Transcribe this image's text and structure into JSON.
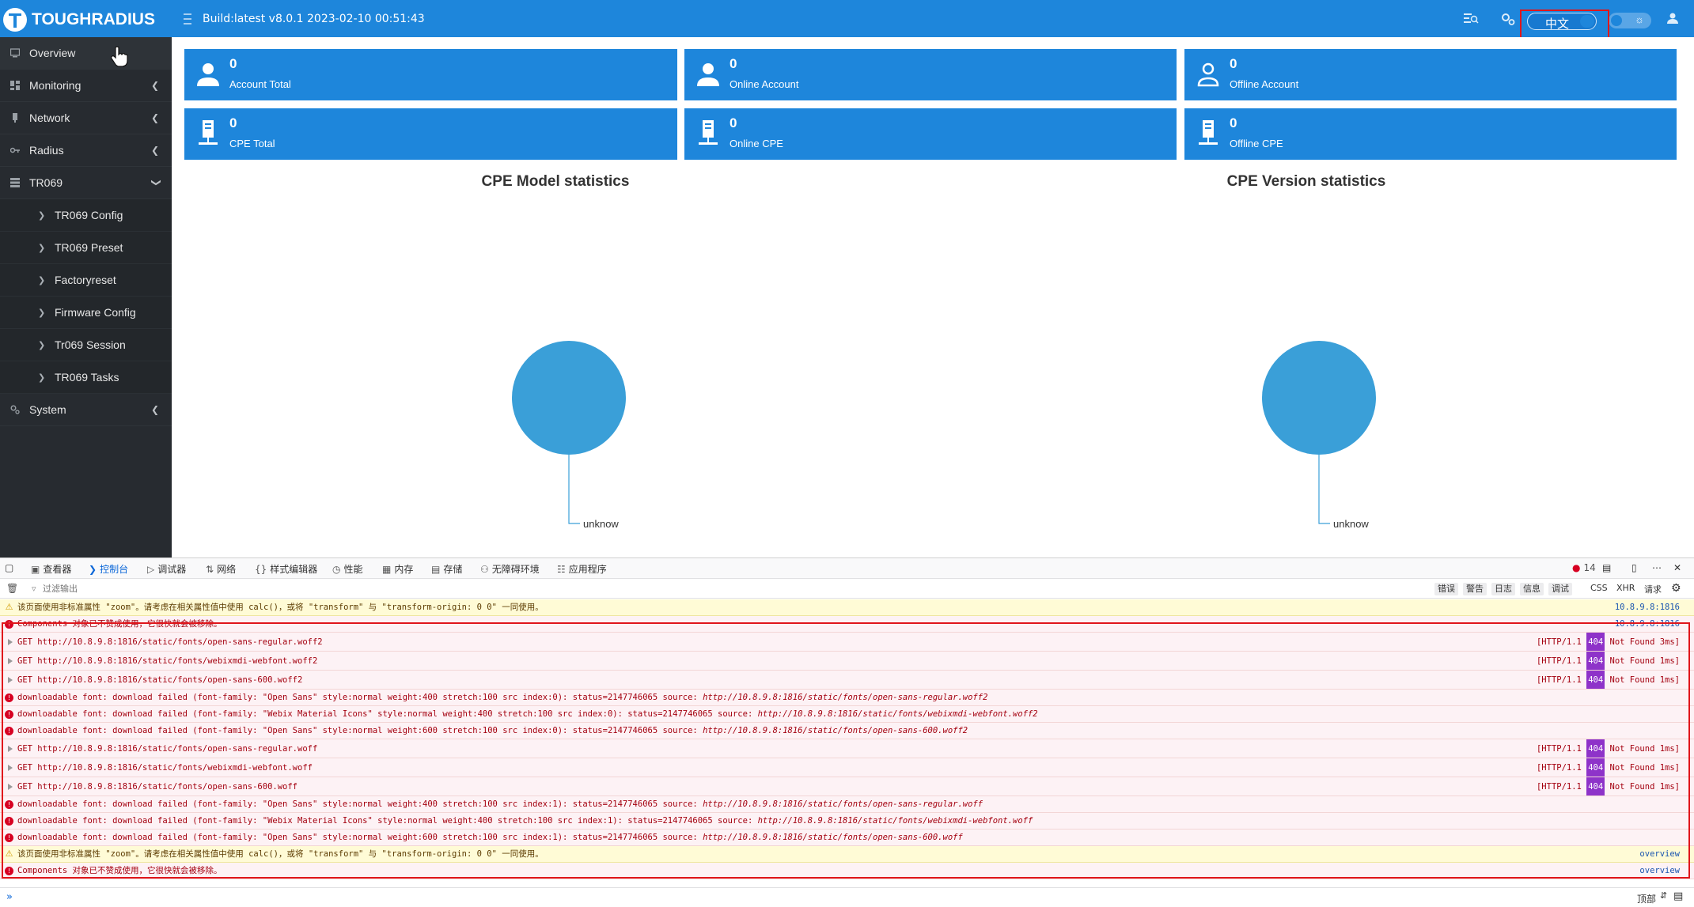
{
  "header": {
    "logo_text": "TOUGHRADIUS",
    "build_info": "Build:latest v8.0.1 2023-02-10 00:51:43",
    "lang_label": "中文",
    "theme_label": "☼"
  },
  "sidebar": {
    "items": [
      {
        "label": "Overview",
        "icon": "monitor-icon"
      },
      {
        "label": "Monitoring",
        "icon": "dashboard-icon"
      },
      {
        "label": "Network",
        "icon": "network-icon"
      },
      {
        "label": "Radius",
        "icon": "key-icon"
      },
      {
        "label": "TR069",
        "icon": "server-icon"
      },
      {
        "label": "System",
        "icon": "gears-icon"
      }
    ],
    "tr069_children": [
      "TR069 Config",
      "TR069 Preset",
      "Factoryreset",
      "Firmware Config",
      "Tr069 Session",
      "TR069 Tasks"
    ]
  },
  "cards": [
    {
      "value": "0",
      "label": "Account Total",
      "icon": "user-icon"
    },
    {
      "value": "0",
      "label": "Online Account",
      "icon": "user-icon"
    },
    {
      "value": "0",
      "label": "Offline Account",
      "icon": "user-outline-icon"
    },
    {
      "value": "0",
      "label": "CPE Total",
      "icon": "device-icon"
    },
    {
      "value": "0",
      "label": "Online CPE",
      "icon": "device-icon"
    },
    {
      "value": "0",
      "label": "Offline CPE",
      "icon": "device-icon"
    }
  ],
  "charts": {
    "model_title": "CPE Model statistics",
    "version_title": "CPE Version statistics"
  },
  "chart_data": [
    {
      "type": "pie",
      "title": "CPE Model statistics",
      "categories": [
        "unknow"
      ],
      "values": [
        1
      ],
      "color": "#3a9fd8"
    },
    {
      "type": "pie",
      "title": "CPE Version statistics",
      "categories": [
        "unknow"
      ],
      "values": [
        1
      ],
      "color": "#3a9fd8"
    }
  ],
  "devtools": {
    "tabs": [
      {
        "label": "查看器",
        "icon": "inspector-icon"
      },
      {
        "label": "控制台",
        "icon": "console-icon"
      },
      {
        "label": "调试器",
        "icon": "debugger-icon"
      },
      {
        "label": "网络",
        "icon": "network-icon"
      },
      {
        "label": "样式编辑器",
        "icon": "style-editor-icon"
      },
      {
        "label": "性能",
        "icon": "performance-icon"
      },
      {
        "label": "内存",
        "icon": "memory-icon"
      },
      {
        "label": "存储",
        "icon": "storage-icon"
      },
      {
        "label": "无障碍环境",
        "icon": "accessibility-icon"
      },
      {
        "label": "应用程序",
        "icon": "application-icon"
      }
    ],
    "error_count": "14",
    "filter_placeholder": "过滤输出",
    "filter_buttons": [
      "错误",
      "警告",
      "日志",
      "信息",
      "调试"
    ],
    "filter_extra": [
      "CSS",
      "XHR",
      "请求"
    ],
    "input_position_label": "顶部",
    "log": [
      {
        "kind": "warn",
        "text": "该页面使用非标准属性 \"zoom\"。请考虑在相关属性值中使用 calc()，或将 \"transform\" 与 \"transform-origin: 0 0\" 一同使用。",
        "src": "10.8.9.8:1816"
      },
      {
        "kind": "err",
        "text": "Components 对象已不赞成使用，它很快就会被移除。",
        "src": "10.8.9.8:1816"
      },
      {
        "kind": "net",
        "text": "GET http://10.8.9.8:1816/static/fonts/open-sans-regular.woff2",
        "http_pre": "[HTTP/1.1 ",
        "http_code": "404",
        "http_post": " Not Found 3ms]"
      },
      {
        "kind": "net",
        "text": "GET http://10.8.9.8:1816/static/fonts/webixmdi-webfont.woff2",
        "http_pre": "[HTTP/1.1 ",
        "http_code": "404",
        "http_post": " Not Found 1ms]"
      },
      {
        "kind": "net",
        "text": "GET http://10.8.9.8:1816/static/fonts/open-sans-600.woff2",
        "http_pre": "[HTTP/1.1 ",
        "http_code": "404",
        "http_post": " Not Found 1ms]"
      },
      {
        "kind": "err",
        "text": "downloadable font: download failed (font-family: \"Open Sans\" style:normal weight:400 stretch:100 src index:0): status=2147746065 source: ",
        "url": "http://10.8.9.8:1816/static/fonts/open-sans-regular.woff2"
      },
      {
        "kind": "err",
        "text": "downloadable font: download failed (font-family: \"Webix Material Icons\" style:normal weight:400 stretch:100 src index:0): status=2147746065 source: ",
        "url": "http://10.8.9.8:1816/static/fonts/webixmdi-webfont.woff2"
      },
      {
        "kind": "err",
        "text": "downloadable font: download failed (font-family: \"Open Sans\" style:normal weight:600 stretch:100 src index:0): status=2147746065 source: ",
        "url": "http://10.8.9.8:1816/static/fonts/open-sans-600.woff2"
      },
      {
        "kind": "net",
        "text": "GET http://10.8.9.8:1816/static/fonts/open-sans-regular.woff",
        "http_pre": "[HTTP/1.1 ",
        "http_code": "404",
        "http_post": " Not Found 1ms]"
      },
      {
        "kind": "net",
        "text": "GET http://10.8.9.8:1816/static/fonts/webixmdi-webfont.woff",
        "http_pre": "[HTTP/1.1 ",
        "http_code": "404",
        "http_post": " Not Found 1ms]"
      },
      {
        "kind": "net",
        "text": "GET http://10.8.9.8:1816/static/fonts/open-sans-600.woff",
        "http_pre": "[HTTP/1.1 ",
        "http_code": "404",
        "http_post": " Not Found 1ms]"
      },
      {
        "kind": "err",
        "text": "downloadable font: download failed (font-family: \"Open Sans\" style:normal weight:400 stretch:100 src index:1): status=2147746065 source: ",
        "url": "http://10.8.9.8:1816/static/fonts/open-sans-regular.woff"
      },
      {
        "kind": "err",
        "text": "downloadable font: download failed (font-family: \"Webix Material Icons\" style:normal weight:400 stretch:100 src index:1): status=2147746065 source: ",
        "url": "http://10.8.9.8:1816/static/fonts/webixmdi-webfont.woff"
      },
      {
        "kind": "err",
        "text": "downloadable font: download failed (font-family: \"Open Sans\" style:normal weight:600 stretch:100 src index:1): status=2147746065 source: ",
        "url": "http://10.8.9.8:1816/static/fonts/open-sans-600.woff"
      },
      {
        "kind": "warn",
        "text": "该页面使用非标准属性 \"zoom\"。请考虑在相关属性值中使用 calc()，或将 \"transform\" 与 \"transform-origin: 0 0\" 一同使用。",
        "src": "overview"
      },
      {
        "kind": "err",
        "text": "Components 对象已不赞成使用，它很快就会被移除。",
        "src": "overview"
      }
    ]
  }
}
